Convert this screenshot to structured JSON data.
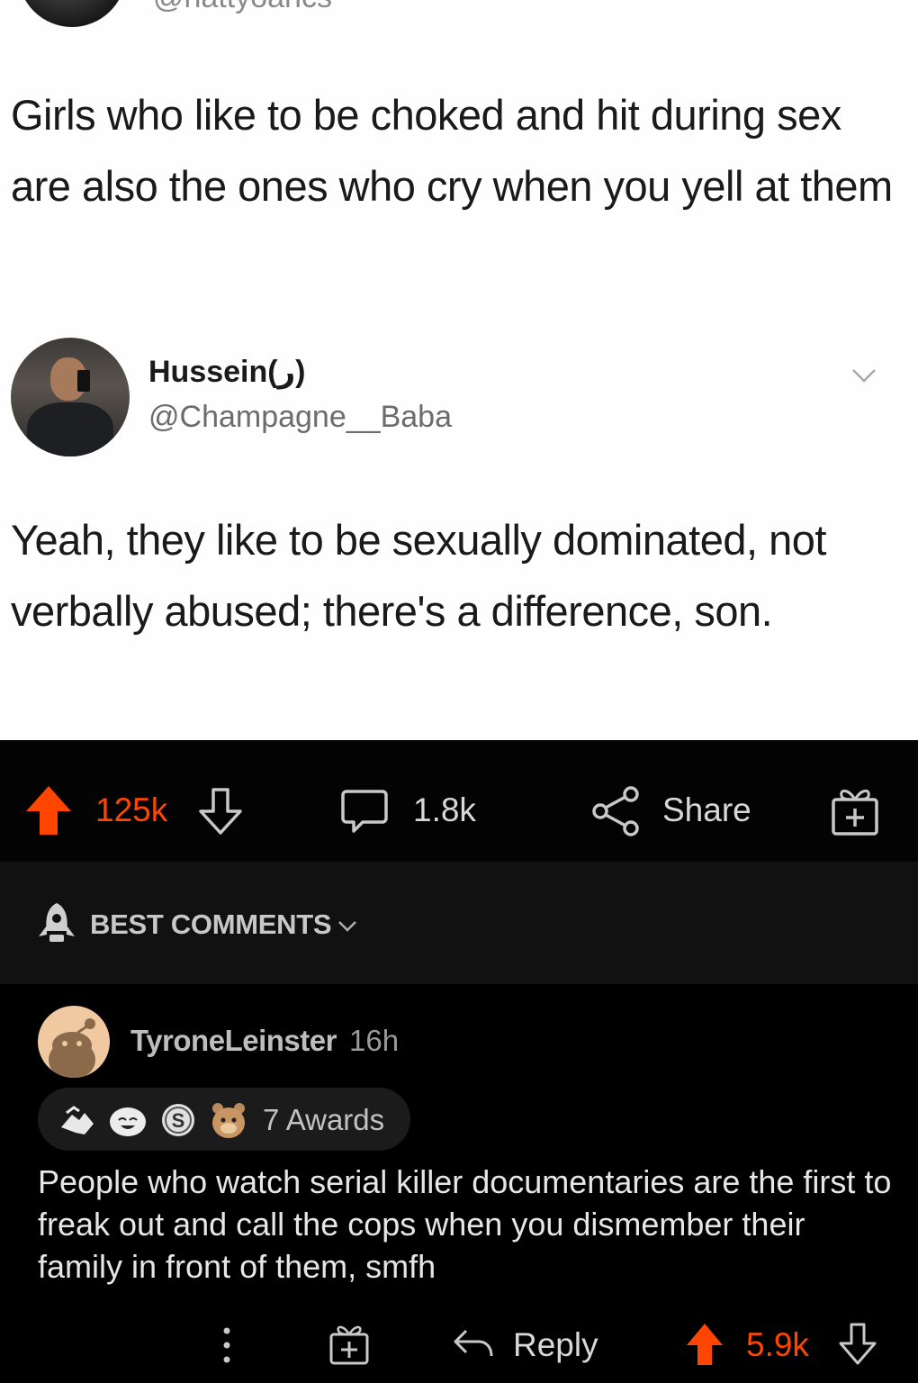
{
  "tweet": {
    "top_handle": "@nattyoancs",
    "text": "Girls who like to be choked and hit during sex are also the ones who cry when you yell at them"
  },
  "reply_tweet": {
    "name": "Hussein(ر)",
    "handle": "@Champagne__Baba",
    "text": "Yeah, they like to be sexually dominated, not verbally abused; there's a difference, son."
  },
  "post_actions": {
    "upvotes": "125k",
    "comments": "1.8k",
    "share_label": "Share"
  },
  "sort": {
    "label": "BEST COMMENTS"
  },
  "comment": {
    "author": "TyroneLeinster",
    "time": "16h",
    "awards_label": "7 Awards",
    "body": "People who watch serial killer documentaries are the first to freak out and call the cops when you dismember their family in front of them, smfh",
    "reply_label": "Reply",
    "score": "5.9k"
  },
  "colors": {
    "upvote": "#ff4500",
    "background_dark": "#000000",
    "tweet_background": "#fefefe"
  },
  "icons": [
    "upvote-icon",
    "downvote-icon",
    "comment-icon",
    "share-icon",
    "gift-icon",
    "rocket-icon",
    "chevron-down-icon",
    "more-icon",
    "reply-icon"
  ]
}
